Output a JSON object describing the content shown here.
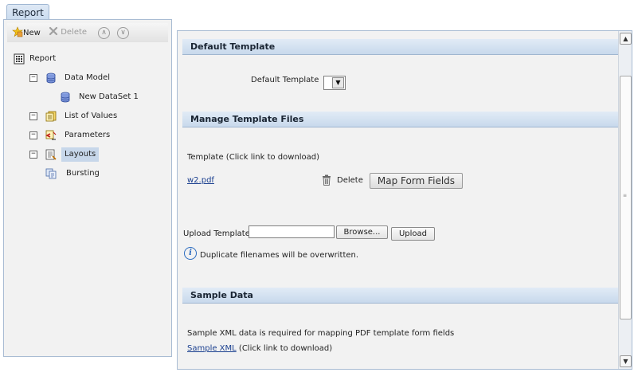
{
  "tab": {
    "label": "Report"
  },
  "toolbar": {
    "new_label": "New",
    "delete_label": "Delete",
    "up_symbol": "∧",
    "down_symbol": "∨"
  },
  "tree": {
    "root": "Report",
    "data_model": "Data Model",
    "new_dataset": "New DataSet 1",
    "list_of_values": "List of Values",
    "parameters": "Parameters",
    "layouts": "Layouts",
    "bursting": "Bursting",
    "expander": "−"
  },
  "default_template": {
    "header": "Default Template",
    "label": "Default Template",
    "value": "",
    "dropdown_arrow": "▼"
  },
  "manage_templates": {
    "header": "Manage Template Files",
    "template_label": "Template (Click link to download)",
    "file_name": "w2.pdf",
    "delete_label": "Delete",
    "map_button": "Map Form Fields",
    "upload_label": "Upload Template:",
    "upload_value": "",
    "browse_button": "Browse...",
    "upload_button": "Upload",
    "info_text": "Duplicate filenames will be overwritten.",
    "info_glyph": "i"
  },
  "sample_data": {
    "header": "Sample Data",
    "description": "Sample XML data is required for mapping PDF template form fields",
    "link_text": "Sample XML",
    "link_suffix": "(Click link to download)"
  },
  "scrollbar": {
    "up_arrow": "▲",
    "down_arrow": "▼",
    "grip": "≡"
  }
}
